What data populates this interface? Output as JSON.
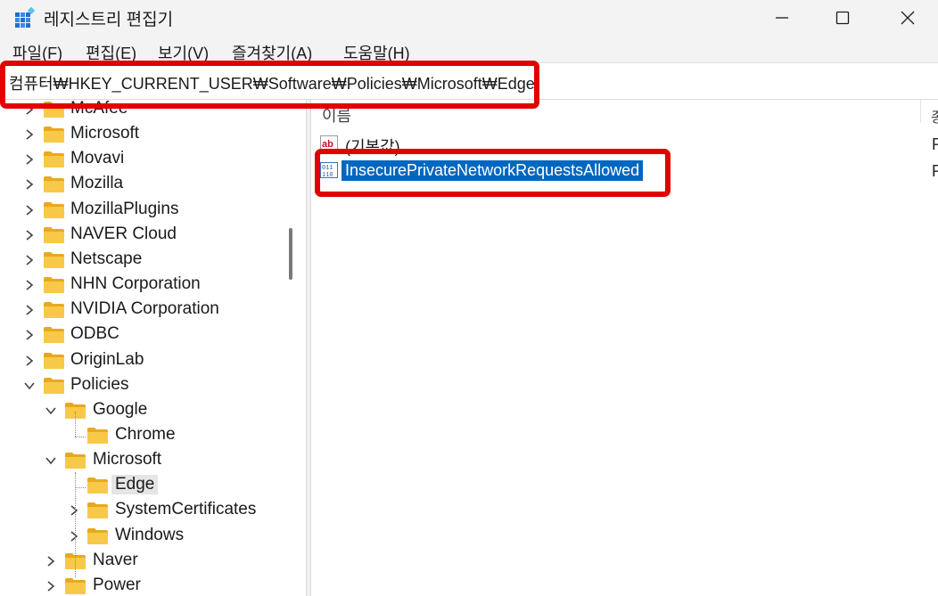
{
  "window": {
    "title": "레지스트리 편집기",
    "controls": {
      "minimize": "minimize-icon",
      "maximize": "maximize-icon",
      "close": "close-icon"
    }
  },
  "menu": [
    "파일(F)",
    "편집(E)",
    "보기(V)",
    "즐겨찾기(A)",
    "도움말(H)"
  ],
  "address": "컴퓨터₩HKEY_CURRENT_USER₩Software₩Policies₩Microsoft₩Edge",
  "tree": {
    "items": [
      {
        "label": "McAfee",
        "level": 0,
        "expanded": false
      },
      {
        "label": "Microsoft",
        "level": 0,
        "expanded": false
      },
      {
        "label": "Movavi",
        "level": 0,
        "expanded": false
      },
      {
        "label": "Mozilla",
        "level": 0,
        "expanded": false
      },
      {
        "label": "MozillaPlugins",
        "level": 0,
        "expanded": false
      },
      {
        "label": "NAVER Cloud",
        "level": 0,
        "expanded": false
      },
      {
        "label": "Netscape",
        "level": 0,
        "expanded": false
      },
      {
        "label": "NHN Corporation",
        "level": 0,
        "expanded": false
      },
      {
        "label": "NVIDIA Corporation",
        "level": 0,
        "expanded": false
      },
      {
        "label": "ODBC",
        "level": 0,
        "expanded": false
      },
      {
        "label": "OriginLab",
        "level": 0,
        "expanded": false
      },
      {
        "label": "Policies",
        "level": 0,
        "expanded": true
      },
      {
        "label": "Google",
        "level": 1,
        "expanded": true
      },
      {
        "label": "Chrome",
        "level": 2,
        "leaf": true
      },
      {
        "label": "Microsoft",
        "level": 1,
        "expanded": true
      },
      {
        "label": "Edge",
        "level": 2,
        "leaf": true,
        "selected": true
      },
      {
        "label": "SystemCertificates",
        "level": 2,
        "expanded": false
      },
      {
        "label": "Windows",
        "level": 2,
        "expanded": false
      },
      {
        "label": "Naver",
        "level": 1,
        "expanded": false
      },
      {
        "label": "Power",
        "level": 1,
        "expanded": false
      }
    ]
  },
  "values": {
    "column_name": "이름",
    "rows": [
      {
        "name": "(기본값)",
        "icon": "string-value-icon",
        "selected": false
      },
      {
        "name": "InsecurePrivateNetworkRequestsAllowed",
        "icon": "dword-value-icon",
        "selected": true
      }
    ]
  },
  "colors": {
    "selection": "#0067c0",
    "highlight": "#e00000",
    "folder": "#f8c948"
  }
}
